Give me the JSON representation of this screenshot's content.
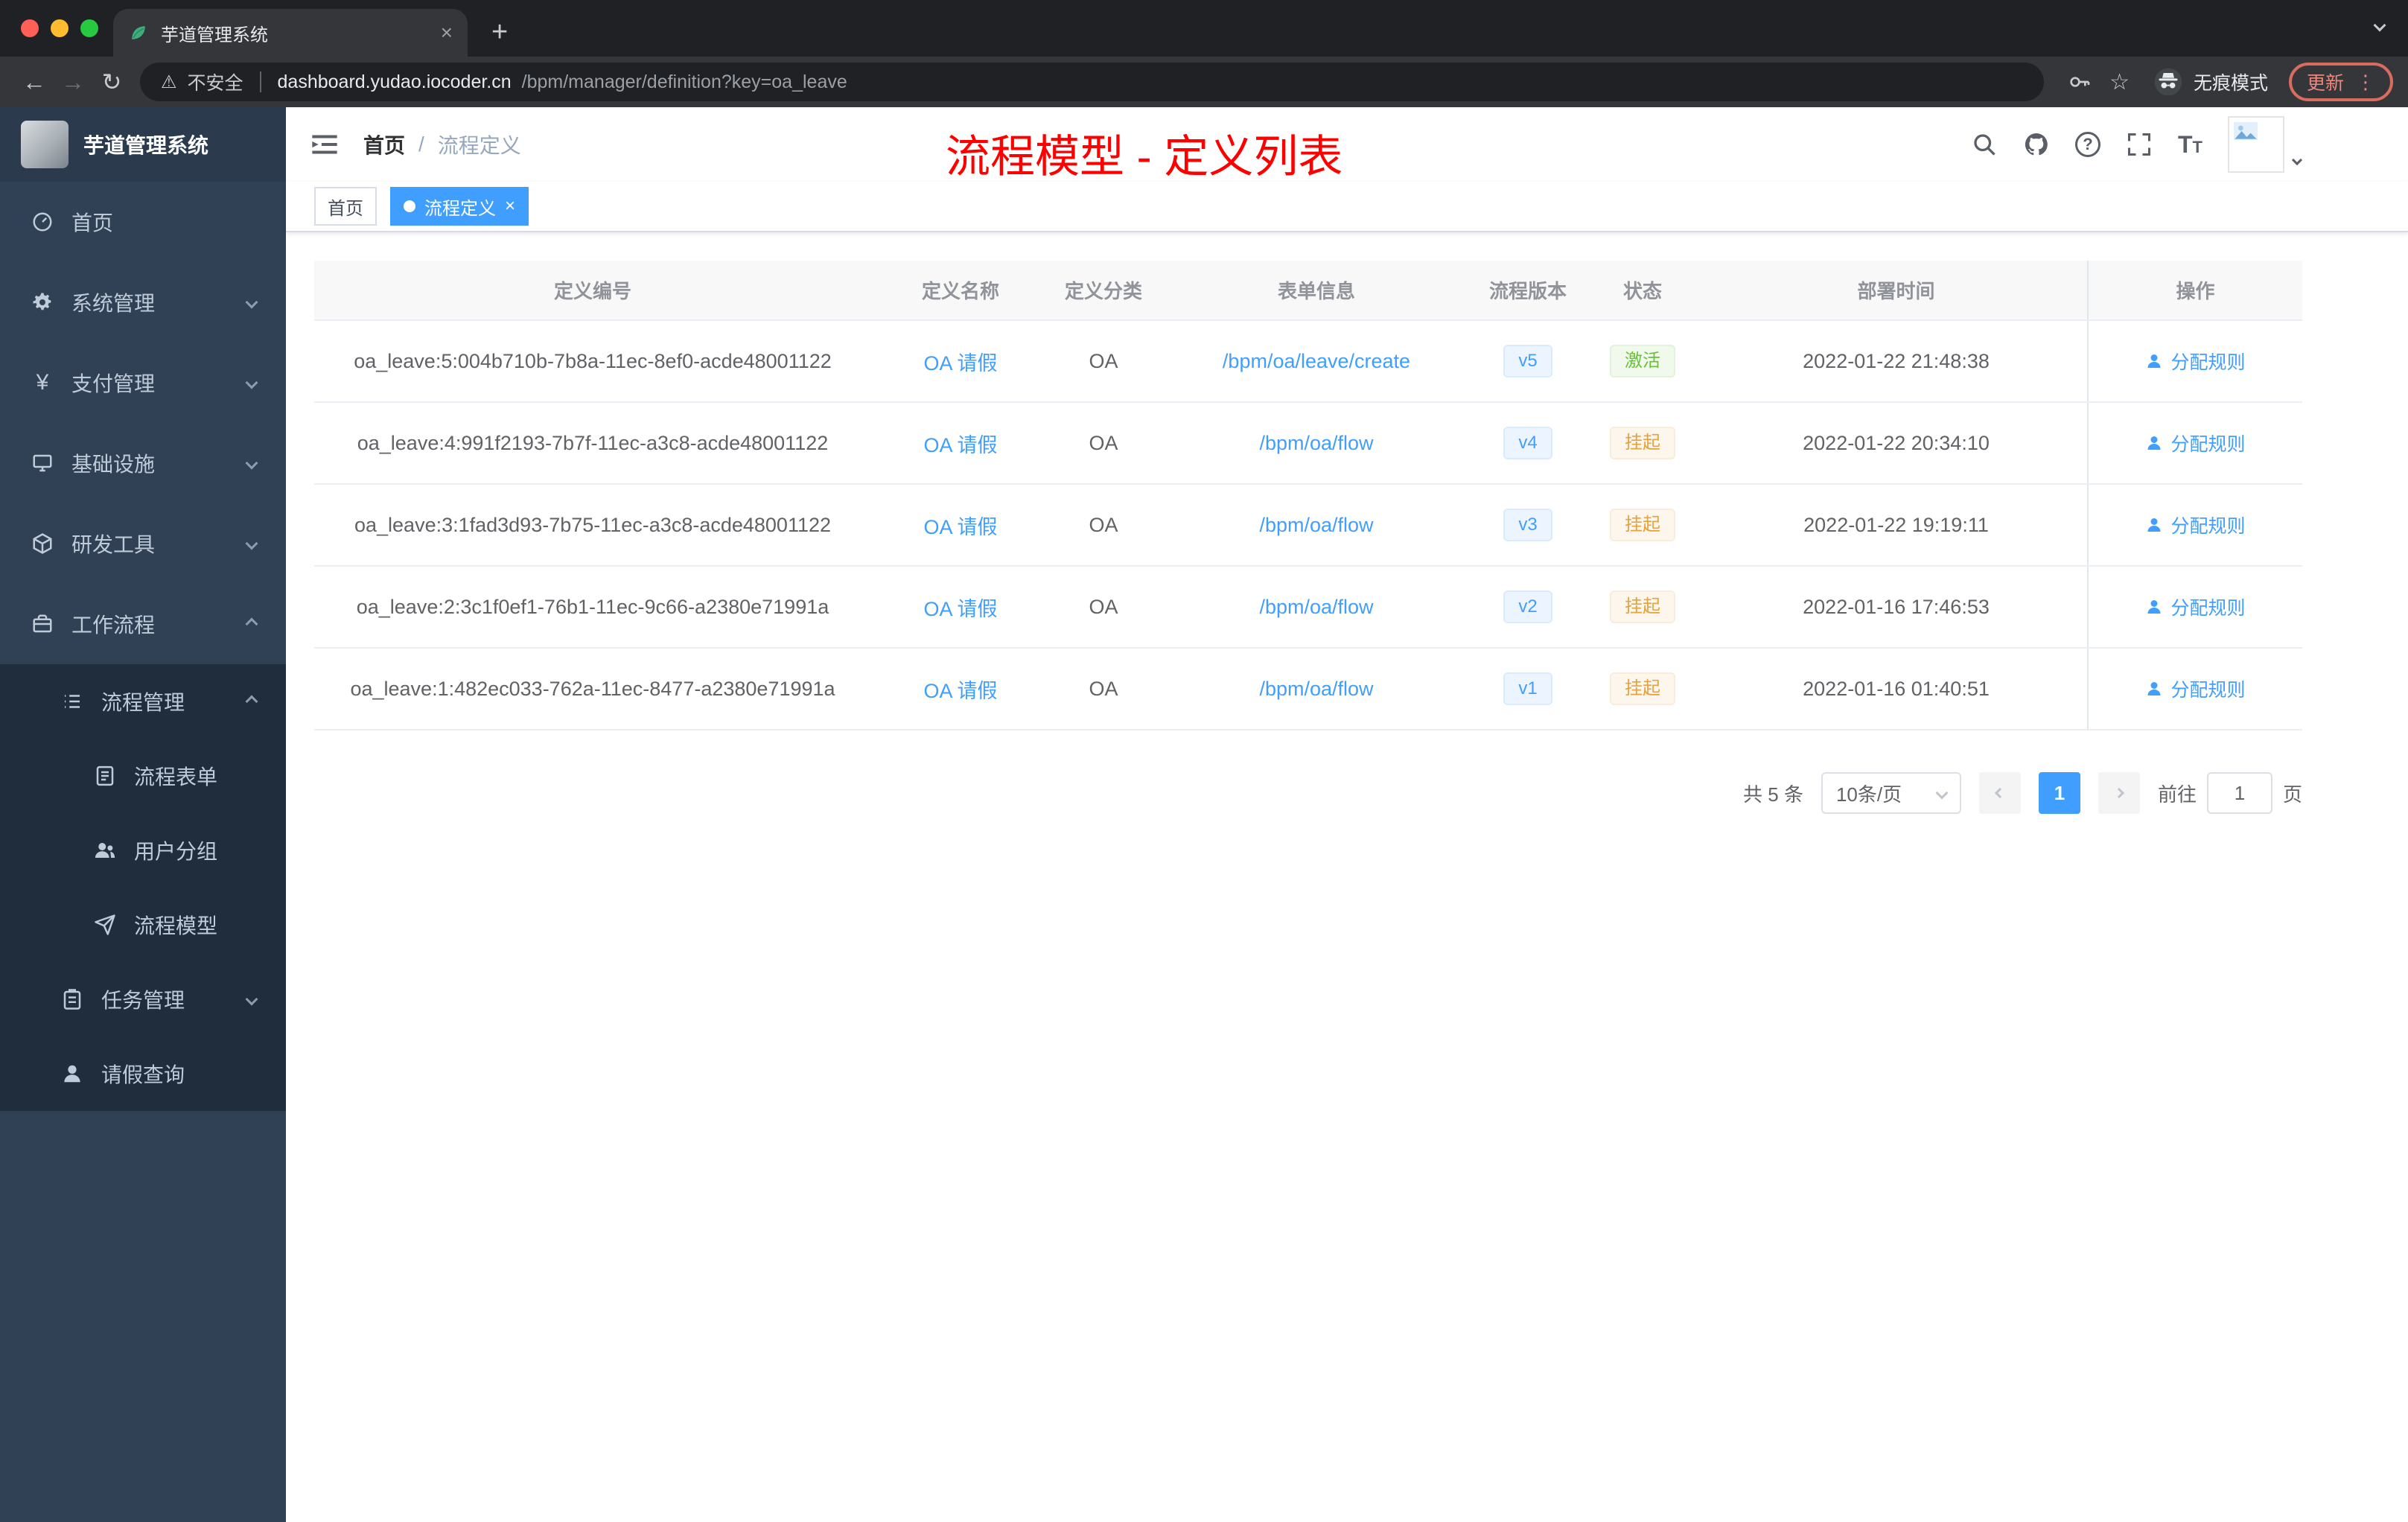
{
  "browser": {
    "tab_title": "芋道管理系统",
    "security": "不安全",
    "url_host": "dashboard.yudao.iocoder.cn",
    "url_path": "/bpm/manager/definition?key=oa_leave",
    "incognito": "无痕模式",
    "update": "更新"
  },
  "sidebar": {
    "app_title": "芋道管理系统",
    "items": {
      "home": "首页",
      "system": "系统管理",
      "payment": "支付管理",
      "infra": "基础设施",
      "devtools": "研发工具",
      "workflow": "工作流程",
      "process_mgmt": "流程管理",
      "process_form": "流程表单",
      "user_group": "用户分组",
      "process_model": "流程模型",
      "task_mgmt": "任务管理",
      "leave_query": "请假查询"
    }
  },
  "navbar": {
    "breadcrumb_home": "首页",
    "breadcrumb_sep": "/",
    "breadcrumb_current": "流程定义",
    "annotation": "流程模型 - 定义列表"
  },
  "tags": {
    "home": "首页",
    "current": "流程定义"
  },
  "table": {
    "columns": [
      "定义编号",
      "定义名称",
      "定义分类",
      "表单信息",
      "流程版本",
      "状态",
      "部署时间",
      "操作"
    ],
    "rows": [
      {
        "id": "oa_leave:5:004b710b-7b8a-11ec-8ef0-acde48001122",
        "name": "OA 请假",
        "category": "OA",
        "form": "/bpm/oa/leave/create",
        "version": "v5",
        "status": "激活",
        "status_type": "success",
        "time": "2022-01-22 21:48:38",
        "action": "分配规则"
      },
      {
        "id": "oa_leave:4:991f2193-7b7f-11ec-a3c8-acde48001122",
        "name": "OA 请假",
        "category": "OA",
        "form": "/bpm/oa/flow",
        "version": "v4",
        "status": "挂起",
        "status_type": "warning",
        "time": "2022-01-22 20:34:10",
        "action": "分配规则"
      },
      {
        "id": "oa_leave:3:1fad3d93-7b75-11ec-a3c8-acde48001122",
        "name": "OA 请假",
        "category": "OA",
        "form": "/bpm/oa/flow",
        "version": "v3",
        "status": "挂起",
        "status_type": "warning",
        "time": "2022-01-22 19:19:11",
        "action": "分配规则"
      },
      {
        "id": "oa_leave:2:3c1f0ef1-76b1-11ec-9c66-a2380e71991a",
        "name": "OA 请假",
        "category": "OA",
        "form": "/bpm/oa/flow",
        "version": "v2",
        "status": "挂起",
        "status_type": "warning",
        "time": "2022-01-16 17:46:53",
        "action": "分配规则"
      },
      {
        "id": "oa_leave:1:482ec033-762a-11ec-8477-a2380e71991a",
        "name": "OA 请假",
        "category": "OA",
        "form": "/bpm/oa/flow",
        "version": "v1",
        "status": "挂起",
        "status_type": "warning",
        "time": "2022-01-16 01:40:51",
        "action": "分配规则"
      }
    ]
  },
  "pagination": {
    "total": "共 5 条",
    "page_size": "10条/页",
    "page": "1",
    "goto_label": "前往",
    "goto_value": "1",
    "goto_unit": "页"
  },
  "colors": {
    "accent": "#409eff",
    "success": "#67c23a",
    "warning": "#e6a23c",
    "annotation_red": "#fe0000",
    "sidebar_bg": "#304156",
    "sidebar_submenu_bg": "#1f2d3d",
    "tag_active_bg": "#409eff"
  }
}
